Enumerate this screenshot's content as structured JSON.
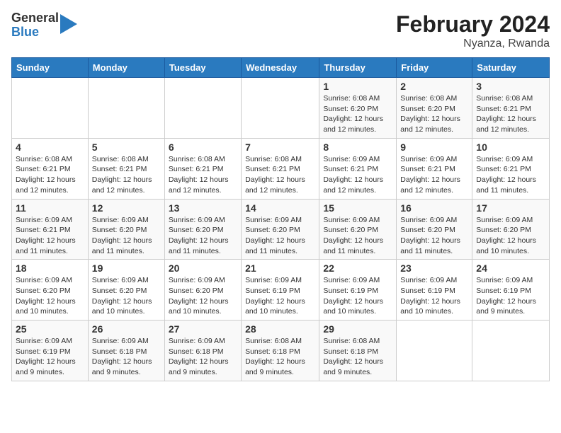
{
  "logo": {
    "general": "General",
    "blue": "Blue"
  },
  "title": {
    "month_year": "February 2024",
    "location": "Nyanza, Rwanda"
  },
  "days_of_week": [
    "Sunday",
    "Monday",
    "Tuesday",
    "Wednesday",
    "Thursday",
    "Friday",
    "Saturday"
  ],
  "weeks": [
    [
      {
        "day": null
      },
      {
        "day": null
      },
      {
        "day": null
      },
      {
        "day": null
      },
      {
        "day": 1,
        "sunrise": "6:08 AM",
        "sunset": "6:20 PM",
        "daylight": "12 hours and 12 minutes."
      },
      {
        "day": 2,
        "sunrise": "6:08 AM",
        "sunset": "6:20 PM",
        "daylight": "12 hours and 12 minutes."
      },
      {
        "day": 3,
        "sunrise": "6:08 AM",
        "sunset": "6:21 PM",
        "daylight": "12 hours and 12 minutes."
      }
    ],
    [
      {
        "day": 4,
        "sunrise": "6:08 AM",
        "sunset": "6:21 PM",
        "daylight": "12 hours and 12 minutes."
      },
      {
        "day": 5,
        "sunrise": "6:08 AM",
        "sunset": "6:21 PM",
        "daylight": "12 hours and 12 minutes."
      },
      {
        "day": 6,
        "sunrise": "6:08 AM",
        "sunset": "6:21 PM",
        "daylight": "12 hours and 12 minutes."
      },
      {
        "day": 7,
        "sunrise": "6:08 AM",
        "sunset": "6:21 PM",
        "daylight": "12 hours and 12 minutes."
      },
      {
        "day": 8,
        "sunrise": "6:09 AM",
        "sunset": "6:21 PM",
        "daylight": "12 hours and 12 minutes."
      },
      {
        "day": 9,
        "sunrise": "6:09 AM",
        "sunset": "6:21 PM",
        "daylight": "12 hours and 12 minutes."
      },
      {
        "day": 10,
        "sunrise": "6:09 AM",
        "sunset": "6:21 PM",
        "daylight": "12 hours and 11 minutes."
      }
    ],
    [
      {
        "day": 11,
        "sunrise": "6:09 AM",
        "sunset": "6:21 PM",
        "daylight": "12 hours and 11 minutes."
      },
      {
        "day": 12,
        "sunrise": "6:09 AM",
        "sunset": "6:20 PM",
        "daylight": "12 hours and 11 minutes."
      },
      {
        "day": 13,
        "sunrise": "6:09 AM",
        "sunset": "6:20 PM",
        "daylight": "12 hours and 11 minutes."
      },
      {
        "day": 14,
        "sunrise": "6:09 AM",
        "sunset": "6:20 PM",
        "daylight": "12 hours and 11 minutes."
      },
      {
        "day": 15,
        "sunrise": "6:09 AM",
        "sunset": "6:20 PM",
        "daylight": "12 hours and 11 minutes."
      },
      {
        "day": 16,
        "sunrise": "6:09 AM",
        "sunset": "6:20 PM",
        "daylight": "12 hours and 11 minutes."
      },
      {
        "day": 17,
        "sunrise": "6:09 AM",
        "sunset": "6:20 PM",
        "daylight": "12 hours and 10 minutes."
      }
    ],
    [
      {
        "day": 18,
        "sunrise": "6:09 AM",
        "sunset": "6:20 PM",
        "daylight": "12 hours and 10 minutes."
      },
      {
        "day": 19,
        "sunrise": "6:09 AM",
        "sunset": "6:20 PM",
        "daylight": "12 hours and 10 minutes."
      },
      {
        "day": 20,
        "sunrise": "6:09 AM",
        "sunset": "6:20 PM",
        "daylight": "12 hours and 10 minutes."
      },
      {
        "day": 21,
        "sunrise": "6:09 AM",
        "sunset": "6:19 PM",
        "daylight": "12 hours and 10 minutes."
      },
      {
        "day": 22,
        "sunrise": "6:09 AM",
        "sunset": "6:19 PM",
        "daylight": "12 hours and 10 minutes."
      },
      {
        "day": 23,
        "sunrise": "6:09 AM",
        "sunset": "6:19 PM",
        "daylight": "12 hours and 10 minutes."
      },
      {
        "day": 24,
        "sunrise": "6:09 AM",
        "sunset": "6:19 PM",
        "daylight": "12 hours and 9 minutes."
      }
    ],
    [
      {
        "day": 25,
        "sunrise": "6:09 AM",
        "sunset": "6:19 PM",
        "daylight": "12 hours and 9 minutes."
      },
      {
        "day": 26,
        "sunrise": "6:09 AM",
        "sunset": "6:18 PM",
        "daylight": "12 hours and 9 minutes."
      },
      {
        "day": 27,
        "sunrise": "6:09 AM",
        "sunset": "6:18 PM",
        "daylight": "12 hours and 9 minutes."
      },
      {
        "day": 28,
        "sunrise": "6:08 AM",
        "sunset": "6:18 PM",
        "daylight": "12 hours and 9 minutes."
      },
      {
        "day": 29,
        "sunrise": "6:08 AM",
        "sunset": "6:18 PM",
        "daylight": "12 hours and 9 minutes."
      },
      {
        "day": null
      },
      {
        "day": null
      }
    ]
  ],
  "labels": {
    "sunrise_prefix": "Sunrise:",
    "sunset_prefix": "Sunset:",
    "daylight_prefix": "Daylight:"
  }
}
